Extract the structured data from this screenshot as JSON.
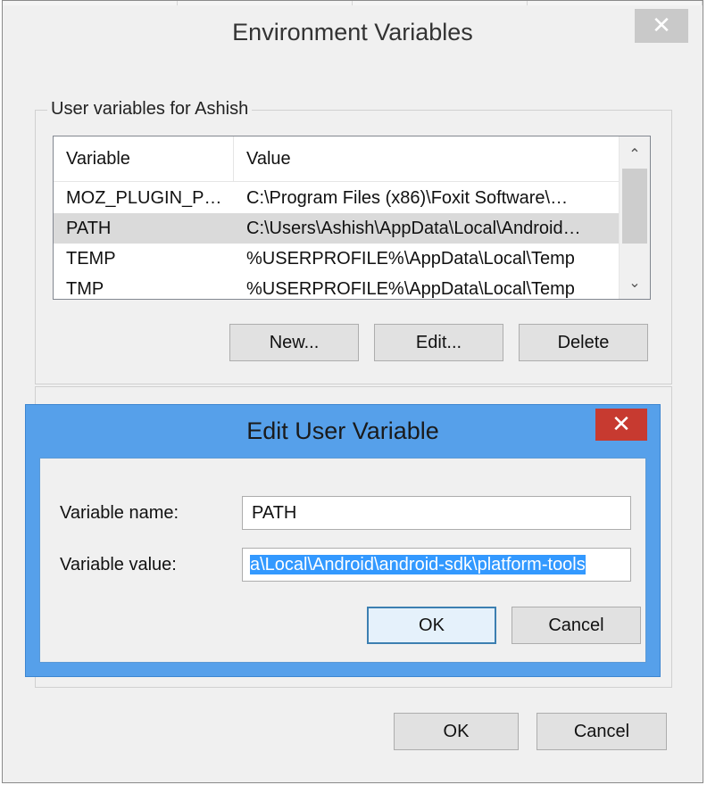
{
  "env_dialog": {
    "title": "Environment Variables",
    "close_glyph": "✕",
    "group_label": "User variables for Ashish",
    "columns": {
      "variable": "Variable",
      "value": "Value"
    },
    "rows": [
      {
        "variable": "MOZ_PLUGIN_P…",
        "value": "C:\\Program Files (x86)\\Foxit Software\\…"
      },
      {
        "variable": "PATH",
        "value": "C:\\Users\\Ashish\\AppData\\Local\\Android…"
      },
      {
        "variable": "TEMP",
        "value": "%USERPROFILE%\\AppData\\Local\\Temp"
      },
      {
        "variable": "TMP",
        "value": "%USERPROFILE%\\AppData\\Local\\Temp"
      }
    ],
    "selected_row": 1,
    "scroll_up_glyph": "⌃",
    "scroll_down_glyph": "⌄",
    "buttons": {
      "new": "New...",
      "edit": "Edit...",
      "delete": "Delete",
      "ok": "OK",
      "cancel": "Cancel"
    }
  },
  "edit_dialog": {
    "title": "Edit User Variable",
    "close_glyph": "✕",
    "name_label": "Variable name:",
    "name_value": "PATH",
    "value_label": "Variable value:",
    "value_value": "a\\Local\\Android\\android-sdk\\platform-tools",
    "buttons": {
      "ok": "OK",
      "cancel": "Cancel"
    }
  },
  "colors": {
    "accent_blue": "#56a0ea",
    "close_red": "#c73a30",
    "selection": "#3399ff"
  }
}
